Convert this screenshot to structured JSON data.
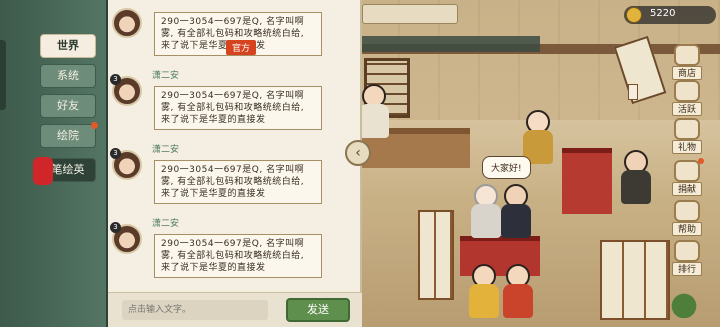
{
  "nav": {
    "items": [
      {
        "label": "世界",
        "active": true
      },
      {
        "label": "系统",
        "active": false
      },
      {
        "label": "好友",
        "active": false
      },
      {
        "label": "绘院",
        "active": false,
        "notify": true
      },
      {
        "label": "笔绘英",
        "active": false
      }
    ]
  },
  "chat": {
    "official_tag": "官方",
    "messages": [
      {
        "name": "",
        "level": "",
        "text": "290一3054一697是Q, 名字叫啊雾, 有全部礼包码和攻略统统白给, 来了说下是华夏的直接发"
      },
      {
        "name": "潇二安",
        "level": "3",
        "text": "290一3054一697是Q, 名字叫啊雾, 有全部礼包码和攻略统统白给, 来了说下是华夏的直接发"
      },
      {
        "name": "潇二安",
        "level": "3",
        "text": "290一3054一697是Q, 名字叫啊雾, 有全部礼包码和攻略统统白给, 来了说下是华夏的直接发"
      },
      {
        "name": "潇二安",
        "level": "3",
        "text": "290一3054一697是Q, 名字叫啊雾, 有全部礼包码和攻略统统白给, 来了说下是华夏的直接发"
      }
    ],
    "input_placeholder": "点击输入文字。",
    "send_label": "发送"
  },
  "hud": {
    "coins": "5220",
    "speech": "大家好!"
  },
  "menu": [
    {
      "label": "商店",
      "notify": false
    },
    {
      "label": "活跃",
      "notify": false
    },
    {
      "label": "礼物",
      "notify": false
    },
    {
      "label": "捐献",
      "notify": true
    },
    {
      "label": "帮助",
      "notify": false
    },
    {
      "label": "排行",
      "notify": false
    }
  ],
  "colors": {
    "accent": "#5f8f4d",
    "panel": "#f4efe2",
    "nav": "#3d5a4b",
    "notify": "#e05a2a",
    "official": "#d5441e"
  },
  "icons": {
    "collapse": "chevron-left-icon",
    "coin": "coin-icon"
  }
}
